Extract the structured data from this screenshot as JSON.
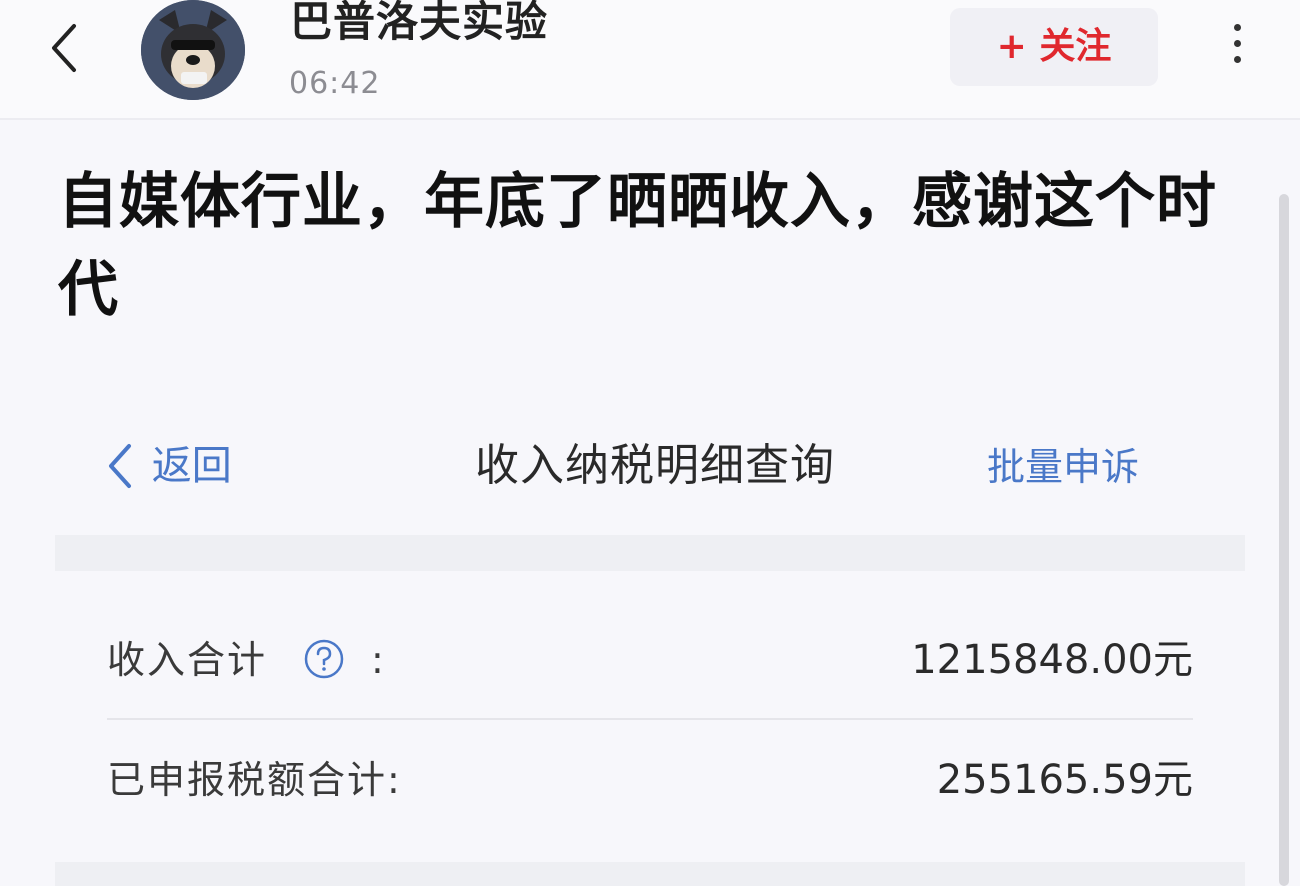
{
  "header": {
    "back_icon": "chevron-left-icon",
    "author_name": "巴普洛夫实验",
    "post_time": "06:42",
    "follow_label": "+ 关注",
    "more_icon": "more-vertical-icon"
  },
  "post": {
    "title": "自媒体行业，年底了晒晒收入，感谢这个时代"
  },
  "embedded_screen": {
    "back_label": "返回",
    "title": "收入纳税明细查询",
    "action_label": "批量申诉",
    "rows": [
      {
        "label": "收入合计",
        "has_help": true,
        "colon": ":",
        "value": "1215848.00元"
      },
      {
        "label": "已申报税额合计:",
        "has_help": false,
        "colon": "",
        "value": "255165.59元"
      }
    ]
  },
  "colors": {
    "accent_blue": "#4a78c8",
    "follow_red": "#e0282e",
    "background": "#f7f7fb"
  }
}
